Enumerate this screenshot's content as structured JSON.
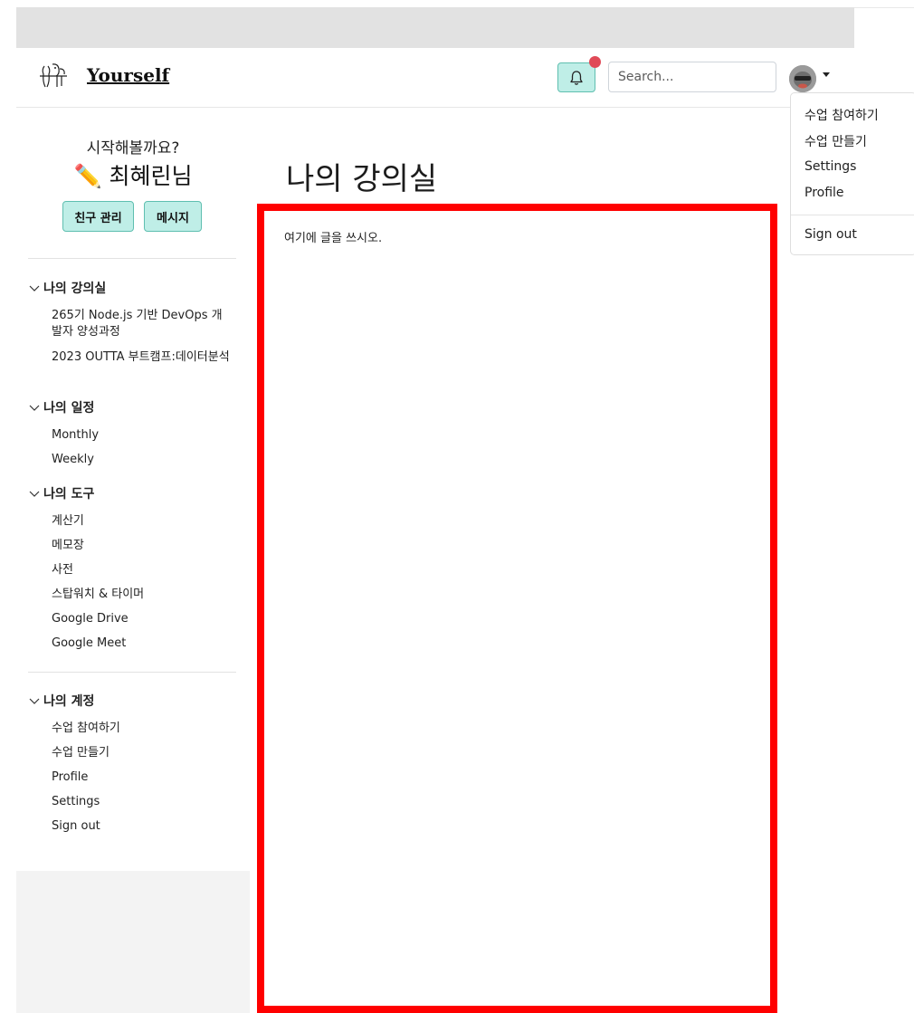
{
  "brand": {
    "name": "Yourself"
  },
  "search": {
    "placeholder": "Search..."
  },
  "account_menu": {
    "items": [
      "수업 참여하기",
      "수업 만들기",
      "Settings",
      "Profile"
    ],
    "sign_out": "Sign out"
  },
  "sidebar": {
    "greeting": "시작해볼까요?",
    "user_name": "✏️ 최혜린님",
    "buttons": {
      "friends": "친구 관리",
      "messages": "메시지"
    },
    "sections": [
      {
        "title": "나의 강의실",
        "items": [
          "265기 Node.js 기반 DevOps 개발자 양성과정",
          "2023 OUTTA 부트캠프:데이터분석"
        ]
      },
      {
        "title": "나의 일정",
        "items": [
          "Monthly",
          "Weekly"
        ]
      },
      {
        "title": "나의 도구",
        "items": [
          "계산기",
          "메모장",
          "사전",
          "스탑워치 & 타이머",
          "Google Drive",
          "Google Meet"
        ]
      },
      {
        "title": "나의 계정",
        "items": [
          "수업 참여하기",
          "수업 만들기",
          "Profile",
          "Settings",
          "Sign out"
        ]
      }
    ]
  },
  "main": {
    "title": "나의 강의실",
    "editor_text": "여기에 글을 쓰시오."
  },
  "colors": {
    "accent": "#bfeee7",
    "accent_border": "#5fbfb0",
    "notification_dot": "#e04a57",
    "editor_border": "#ff0000"
  },
  "icons": {
    "logo": "vegetables-sketch-logo",
    "notification": "bell-icon",
    "section_toggle": "chevron-down-icon"
  }
}
